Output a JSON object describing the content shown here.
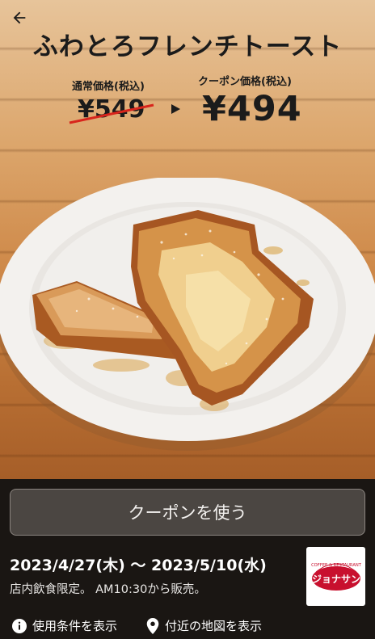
{
  "header": {
    "title": "ふわとろフレンチトースト"
  },
  "price": {
    "regular_label": "通常価格(税込)",
    "regular_value": "¥549",
    "coupon_label": "クーポン価格(税込)",
    "coupon_value": "¥494"
  },
  "panel": {
    "use_button_label": "クーポンを使う",
    "period": "2023/4/27(木) 〜 2023/5/10(水)",
    "note": "店内飲食限定。 AM10:30から販売。",
    "logo_top_text": "COFFEE & RESTAURANT",
    "logo_brand": "ジョナサン",
    "link_terms": "使用条件を表示",
    "link_map": "付近の地図を表示"
  },
  "icons": {
    "back": "back-arrow-icon",
    "info": "info-icon",
    "pin": "map-pin-icon"
  },
  "colors": {
    "strike": "#d8251c",
    "logo_red": "#c8102e"
  }
}
